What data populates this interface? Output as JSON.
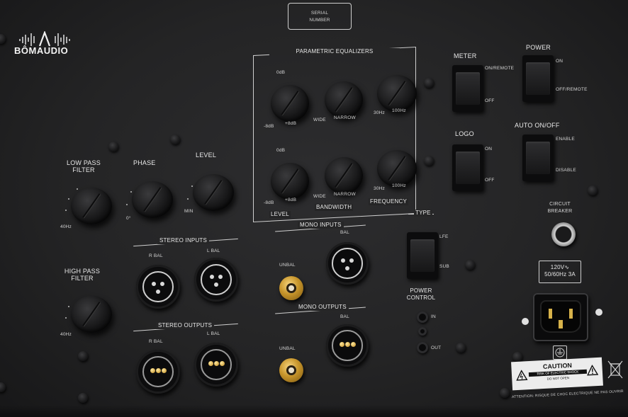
{
  "serial": "SERIAL\nNUMBER",
  "watermark": "BÔMAUDIO",
  "eq": {
    "title": "PARAMETRIC EQUALIZERS",
    "db_top": "0dB",
    "db_min": "-8dB",
    "db_max": "+8dB",
    "wide": "WIDE",
    "narrow": "NARROW",
    "f_lo": "30Hz",
    "f_hi": "100Hz",
    "foot_level": "LEVEL",
    "foot_bw": "BANDWIDTH",
    "foot_freq": "FREQUENCY"
  },
  "controls": {
    "lpf": "LOW PASS\nFILTER",
    "phase": "PHASE",
    "level": "LEVEL",
    "hpf": "HIGH PASS\nFILTER",
    "hz40": "40Hz",
    "deg0": "0°",
    "min": "MIN"
  },
  "switches": {
    "meter": "METER",
    "meter_on": "ON/REMOTE",
    "meter_off": "OFF",
    "power": "POWER",
    "power_on": "ON",
    "power_off": "OFF/REMOTE",
    "logo": "LOGO",
    "logo_on": "ON",
    "logo_off": "OFF",
    "auto": "AUTO ON/OFF",
    "auto_enable": "ENABLE",
    "auto_disable": "DISABLE",
    "type": "TYPE",
    "type_lfe": "LFE",
    "type_sub": "SUB"
  },
  "io": {
    "stereo_in": "STEREO INPUTS",
    "stereo_out": "STEREO OUTPUTS",
    "mono_in": "MONO INPUTS",
    "mono_out": "MONO OUTPUTS",
    "r_bal": "R BAL",
    "l_bal": "L BAL",
    "unbal": "UNBAL",
    "bal": "BAL"
  },
  "power_control": {
    "title": "POWER\nCONTROL",
    "in": "IN",
    "out": "OUT"
  },
  "breaker": "CIRCUIT\nBREAKER",
  "voltage": "120V∿\n50/60Hz 3A",
  "caution": {
    "title": "CAUTION",
    "line1": "RISK OF ELECTRIC SHOCK",
    "line2": "DO NOT OPEN",
    "attention": "ATTENTION: RISQUE DE CHOC ELECTRIQUE NE PAS OUVRIR"
  }
}
